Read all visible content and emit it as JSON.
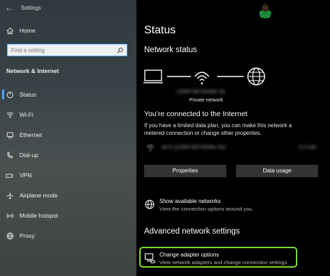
{
  "window": {
    "title": "Settings"
  },
  "sidebar": {
    "home_label": "Home",
    "search_placeholder": "Find a setting",
    "section_title": "Network & Internet",
    "items": [
      {
        "label": "Status",
        "icon": "status-icon",
        "active": true
      },
      {
        "label": "Wi-Fi",
        "icon": "wifi-icon"
      },
      {
        "label": "Ethernet",
        "icon": "ethernet-icon"
      },
      {
        "label": "Dial-up",
        "icon": "dialup-icon"
      },
      {
        "label": "VPN",
        "icon": "vpn-icon"
      },
      {
        "label": "Airplane mode",
        "icon": "airplane-icon"
      },
      {
        "label": "Mobile hotspot",
        "icon": "hotspot-icon"
      },
      {
        "label": "Proxy",
        "icon": "globe-icon"
      }
    ]
  },
  "main": {
    "title": "Status",
    "network_status_heading": "Network status",
    "diagram": {
      "blurred_name": "CORP-NETWORK 5G",
      "network_type": "Private network"
    },
    "connected_heading": "You’re connected to the Internet",
    "connected_text": "If you have a limited data plan, you can make this network a metered connection or change other properties.",
    "blurred_adapter": "Wi-Fi (CORP NETWORK 5G)",
    "blurred_usage": "71.5 GB",
    "properties_button": "Properties",
    "data_usage_button": "Data usage",
    "show_networks_title": "Show available networks",
    "show_networks_desc": "View the connection options around you.",
    "advanced_heading": "Advanced network settings",
    "adapter_title": "Change adapter options",
    "adapter_desc": "View network adapters and change connection settings.",
    "highlight_color": "#7fdc2a",
    "accent_color": "#4da3ff"
  }
}
